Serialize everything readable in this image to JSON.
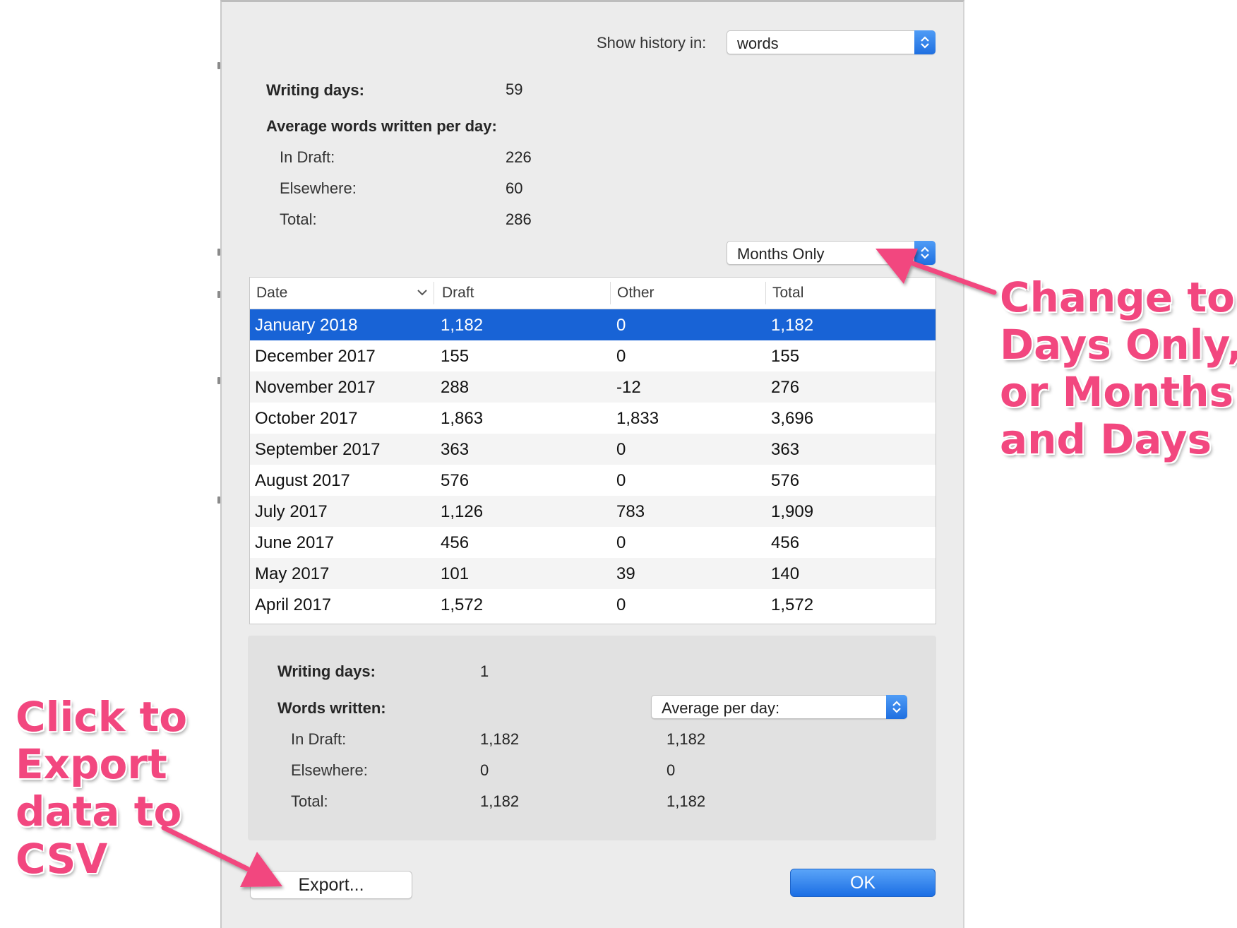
{
  "history": {
    "label": "Show history in:",
    "value": "words"
  },
  "overall": {
    "writing_days_label": "Writing days:",
    "writing_days": "59",
    "avg_heading": "Average words written per day:",
    "rows": [
      {
        "label": "In Draft:",
        "value": "226"
      },
      {
        "label": "Elsewhere:",
        "value": "60"
      },
      {
        "label": "Total:",
        "value": "286"
      }
    ]
  },
  "period_filter": {
    "value": "Months Only"
  },
  "table": {
    "columns": [
      "Date",
      "Draft",
      "Other",
      "Total"
    ],
    "rows": [
      {
        "date": "January 2018",
        "draft": "1,182",
        "other": "0",
        "total": "1,182",
        "selected": true
      },
      {
        "date": "December 2017",
        "draft": "155",
        "other": "0",
        "total": "155"
      },
      {
        "date": "November 2017",
        "draft": "288",
        "other": "-12",
        "total": "276"
      },
      {
        "date": "October 2017",
        "draft": "1,863",
        "other": "1,833",
        "total": "3,696"
      },
      {
        "date": "September 2017",
        "draft": "363",
        "other": "0",
        "total": "363"
      },
      {
        "date": "August 2017",
        "draft": "576",
        "other": "0",
        "total": "576"
      },
      {
        "date": "July 2017",
        "draft": "1,126",
        "other": "783",
        "total": "1,909"
      },
      {
        "date": "June 2017",
        "draft": "456",
        "other": "0",
        "total": "456"
      },
      {
        "date": "May 2017",
        "draft": "101",
        "other": "39",
        "total": "140"
      },
      {
        "date": "April 2017",
        "draft": "1,572",
        "other": "0",
        "total": "1,572"
      }
    ]
  },
  "selection": {
    "writing_days_label": "Writing days:",
    "writing_days": "1",
    "words_label": "Words written:",
    "mode_value": "Average per day:",
    "rows": [
      {
        "label": "In Draft:",
        "value": "1,182",
        "avg": "1,182"
      },
      {
        "label": "Elsewhere:",
        "value": "0",
        "avg": "0"
      },
      {
        "label": "Total:",
        "value": "1,182",
        "avg": "1,182"
      }
    ]
  },
  "buttons": {
    "export": "Export...",
    "ok": "OK"
  },
  "annotations": {
    "right": [
      "Change to",
      "Days Only,",
      "or Months",
      "and Days"
    ],
    "left": [
      "Click to",
      "Export",
      "data to",
      "CSV"
    ]
  },
  "colors": {
    "accent": "#1863d6",
    "annotation": "#f2477f"
  }
}
